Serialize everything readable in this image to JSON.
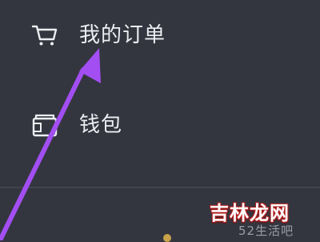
{
  "menu": {
    "items": [
      {
        "label": "我的订单",
        "icon": "shopping-cart-icon"
      },
      {
        "label": "钱包",
        "icon": "wallet-icon"
      }
    ]
  },
  "annotation": {
    "arrow_color": "#a24ef2"
  },
  "watermark": {
    "logo_text": "吉林龙网",
    "site_text": "52生活吧"
  },
  "colors": {
    "background": "#34363f",
    "text": "#eceef2"
  }
}
